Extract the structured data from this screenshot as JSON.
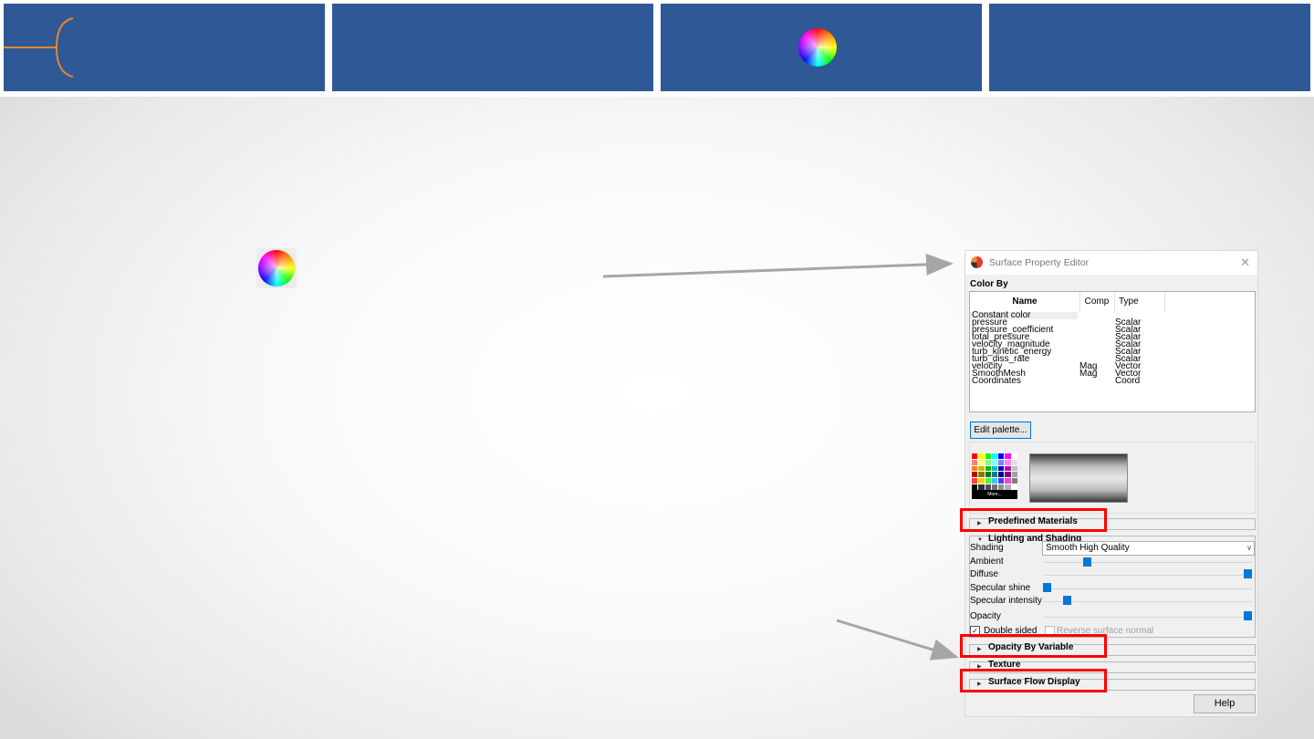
{
  "dialog": {
    "title": "Surface Property Editor",
    "close_glyph": "✕",
    "color_by_label": "Color By",
    "table": {
      "headers": {
        "name": "Name",
        "comp": "Comp",
        "type": "Type"
      },
      "rows": [
        {
          "name": "Constant color",
          "comp": "",
          "type": ""
        },
        {
          "name": "pressure",
          "comp": "",
          "type": "Scalar"
        },
        {
          "name": "pressure_coefficient",
          "comp": "",
          "type": "Scalar"
        },
        {
          "name": "total_pressure",
          "comp": "",
          "type": "Scalar"
        },
        {
          "name": "velocity_magnitude",
          "comp": "",
          "type": "Scalar"
        },
        {
          "name": "turb_kinetic_energy",
          "comp": "",
          "type": "Scalar"
        },
        {
          "name": "turb_diss_rate",
          "comp": "",
          "type": "Scalar"
        },
        {
          "name": "velocity",
          "comp": "Mag",
          "type": "Vector"
        },
        {
          "name": "SmoothMesh",
          "comp": "Mag",
          "type": "Vector"
        },
        {
          "name": "Coordinates",
          "comp": "",
          "type": "Coord"
        }
      ]
    },
    "edit_palette_label": "Edit palette...",
    "palette_more_label": "More...",
    "sections": {
      "predefined_materials": "Predefined Materials",
      "lighting_and_shading": "Lighting and Shading",
      "opacity_by_variable": "Opacity By Variable",
      "texture": "Texture",
      "surface_flow_display": "Surface Flow Display"
    },
    "lighting": {
      "shading_label": "Shading",
      "shading_value": "Smooth High Quality",
      "ambient_label": "Ambient",
      "ambient_level": 0.2,
      "diffuse_label": "Diffuse",
      "diffuse_level": 1.0,
      "specular_shine_label": "Specular shine",
      "specular_shine_level": 0.0,
      "specular_intensity_label": "Specular intensity",
      "specular_intensity_level": 0.1,
      "opacity_label": "Opacity",
      "opacity_level": 1.0,
      "double_sided_label": "Double sided",
      "double_sided_checked": true,
      "reverse_normal_label": "Reverse surface normal",
      "reverse_normal_checked": false
    },
    "help_label": "Help"
  },
  "colors": {
    "banner_blue": "#2f5996",
    "bracket_orange": "#e8862a",
    "highlight_red": "#ff0000",
    "arrow_gray": "#a6a6a6",
    "slider_blue": "#0078d7"
  },
  "icons": [
    "color-wheel-icon",
    "bracket-decoration",
    "app-logo-icon",
    "close-icon",
    "expand-triangle-icon",
    "checkbox-icon",
    "dropdown-arrow-icon"
  ]
}
